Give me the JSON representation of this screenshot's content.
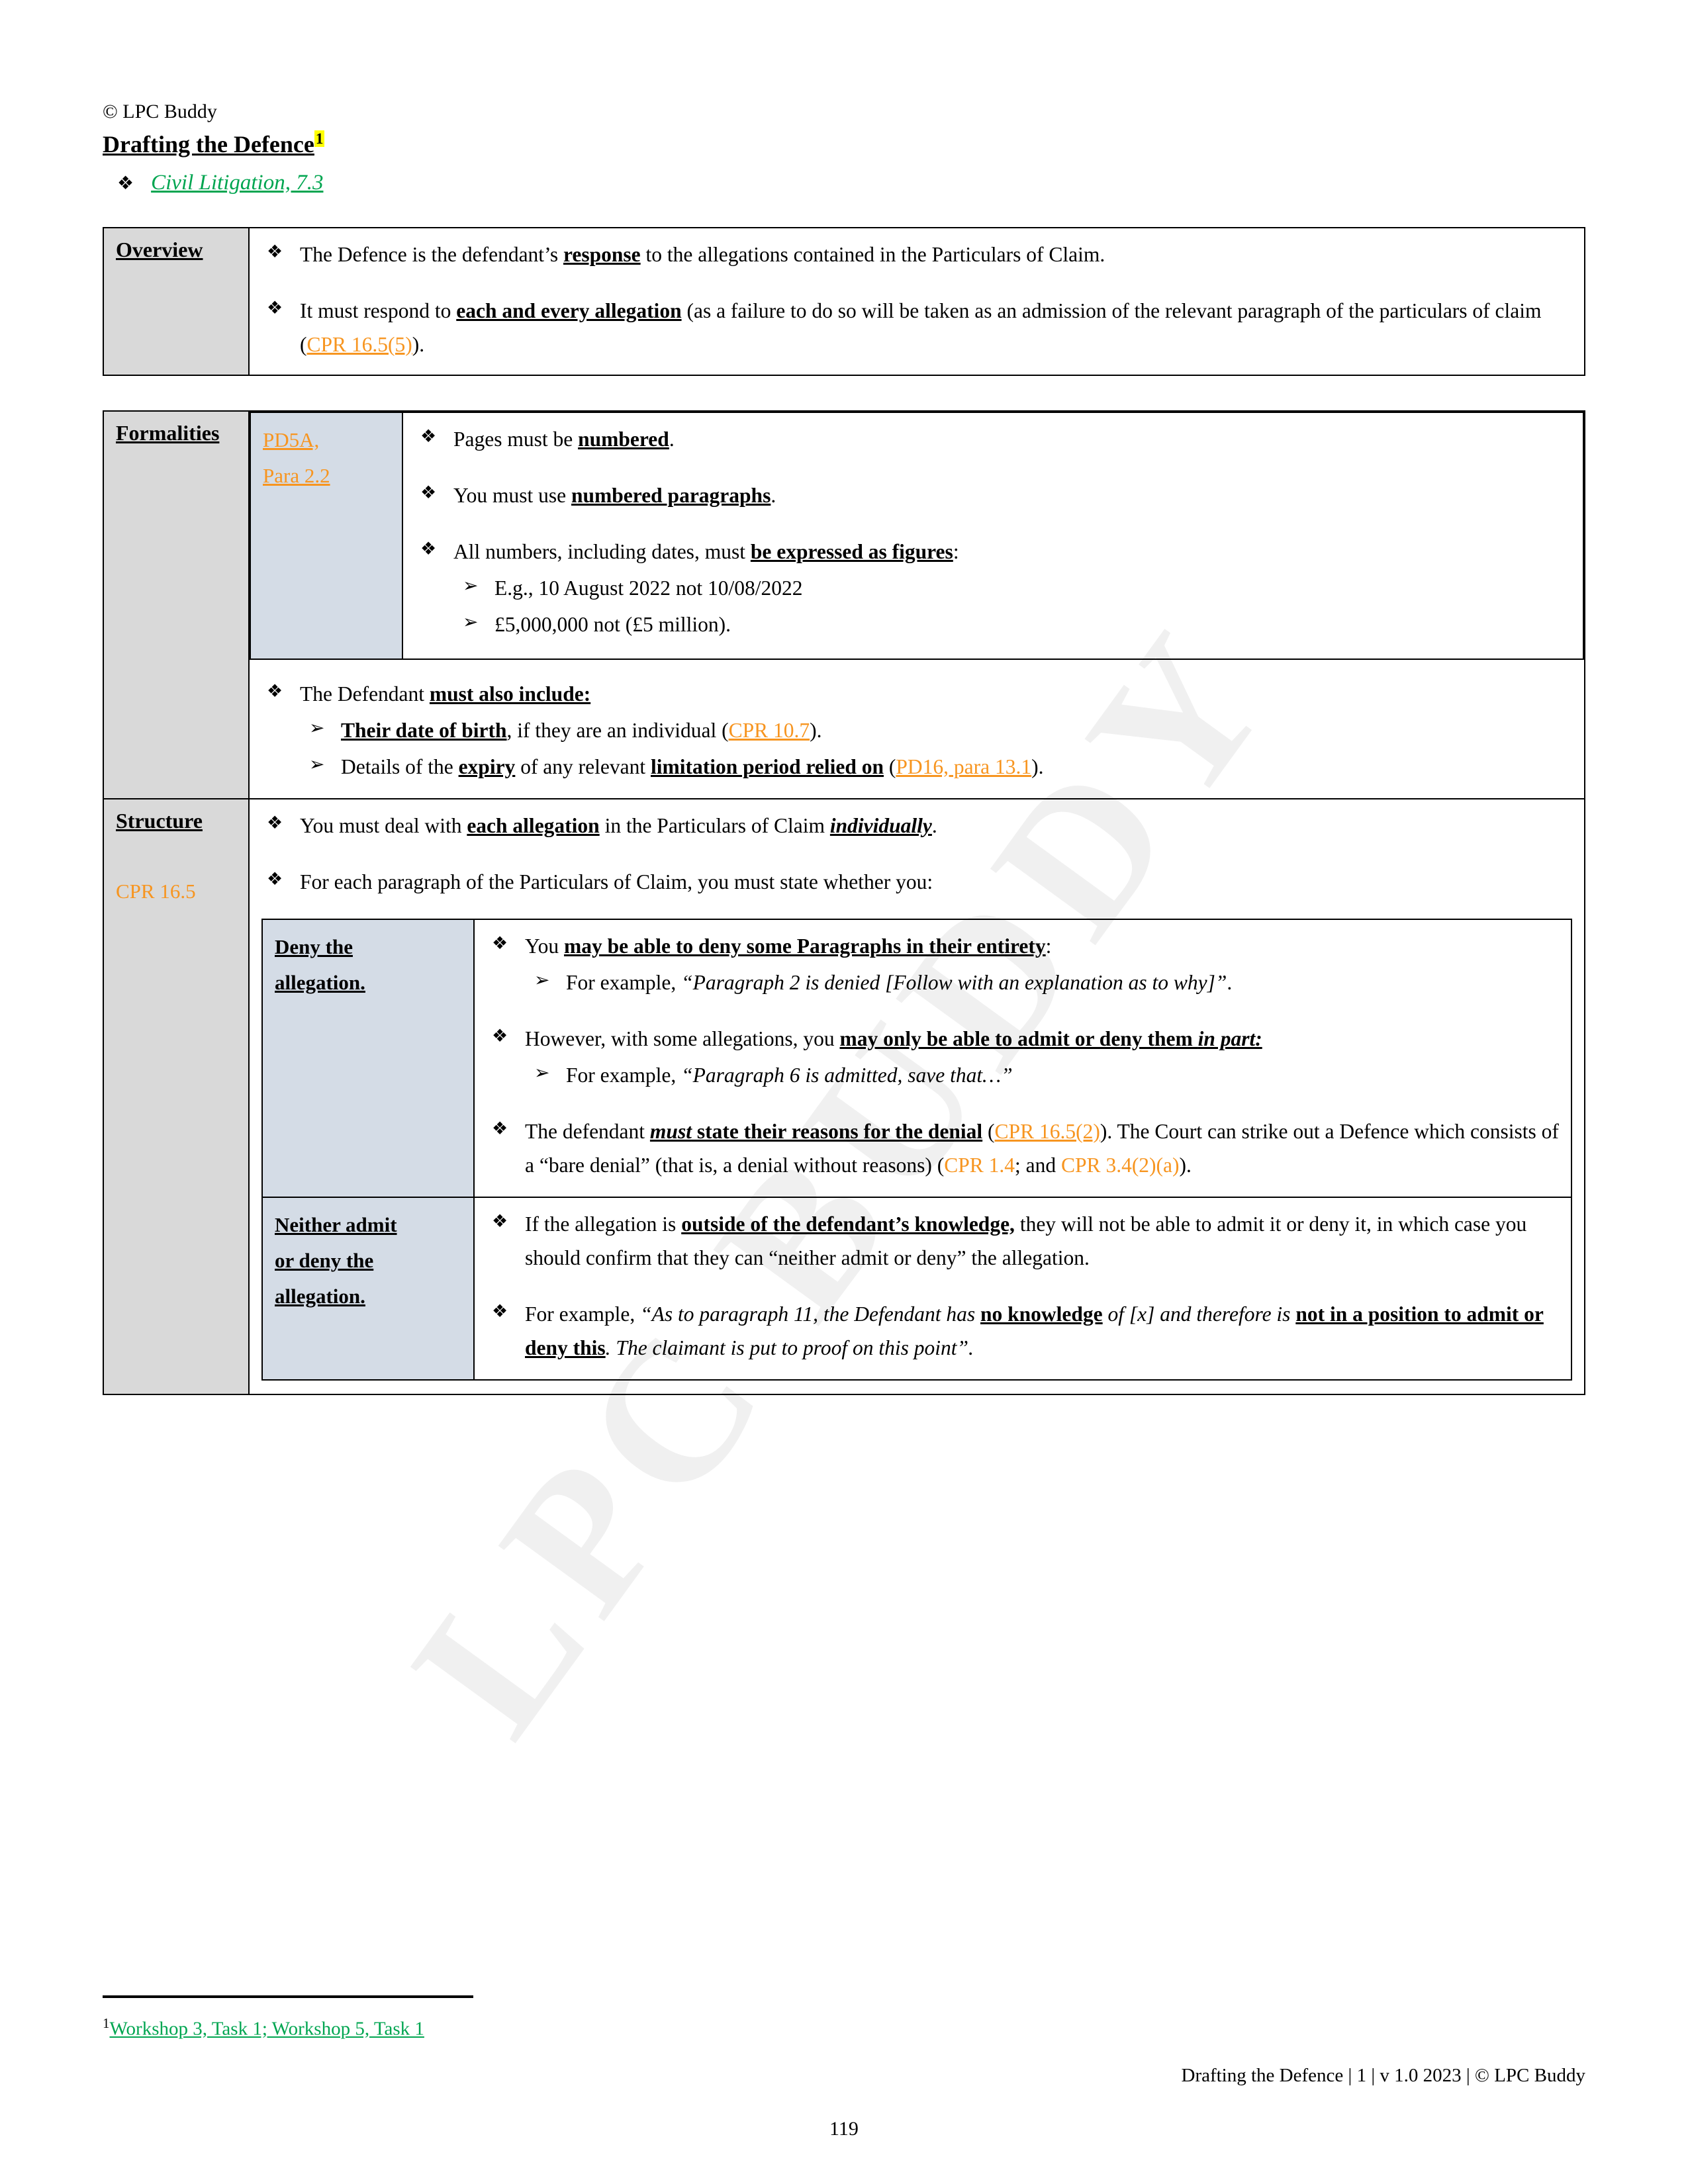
{
  "header": {
    "copyright": "© LPC Buddy",
    "title": "Drafting the Defence",
    "footnote_marker": "1",
    "subject_link": "Civil Litigation, 7.3"
  },
  "overview": {
    "label": "Overview",
    "bullets": [
      {
        "parts": [
          {
            "t": "The Defence is the defendant’s ",
            "s": "plain"
          },
          {
            "t": "response",
            "s": "bu"
          },
          {
            "t": " to the allegations contained in the Particulars of Claim.",
            "s": "plain"
          }
        ]
      },
      {
        "parts": [
          {
            "t": "It must respond to ",
            "s": "plain"
          },
          {
            "t": "each and every allegation",
            "s": "bu"
          },
          {
            "t": " (as a failure to do so will be taken as an admission of the relevant paragraph of the particulars of claim (",
            "s": "plain"
          },
          {
            "t": "CPR 16.5(5)",
            "s": "link"
          },
          {
            "t": ").",
            "s": "plain"
          }
        ]
      }
    ]
  },
  "formalities": {
    "label": "Formalities",
    "citation_lines": [
      "PD5A,",
      "Para 2.2"
    ],
    "bullets": [
      {
        "parts": [
          {
            "t": "Pages must be ",
            "s": "plain"
          },
          {
            "t": "numbered",
            "s": "bu"
          },
          {
            "t": ".",
            "s": "plain"
          }
        ]
      },
      {
        "parts": [
          {
            "t": "You must use ",
            "s": "plain"
          },
          {
            "t": "numbered paragraphs",
            "s": "bu"
          },
          {
            "t": ".",
            "s": "plain"
          }
        ]
      },
      {
        "parts": [
          {
            "t": "All numbers, including dates, must ",
            "s": "plain"
          },
          {
            "t": "be expressed as figures",
            "s": "bu"
          },
          {
            "t": ":",
            "s": "plain"
          }
        ],
        "sub": [
          {
            "parts": [
              {
                "t": "E.g., 10 August 2022 not 10/08/2022",
                "s": "plain"
              }
            ]
          },
          {
            "parts": [
              {
                "t": "£5,000,000 not (£5 million).",
                "s": "plain"
              }
            ]
          }
        ]
      }
    ],
    "outer_bullets": [
      {
        "parts": [
          {
            "t": "The Defendant ",
            "s": "plain"
          },
          {
            "t": "must also include:",
            "s": "bu"
          }
        ],
        "sub": [
          {
            "parts": [
              {
                "t": "Their date of birth",
                "s": "bu"
              },
              {
                "t": ", if they are an individual (",
                "s": "plain"
              },
              {
                "t": "CPR 10.7",
                "s": "link"
              },
              {
                "t": ").",
                "s": "plain"
              }
            ]
          },
          {
            "parts": [
              {
                "t": "Details of the ",
                "s": "plain"
              },
              {
                "t": "expiry",
                "s": "bu"
              },
              {
                "t": " of any relevant ",
                "s": "plain"
              },
              {
                "t": "limitation period relied on",
                "s": "bu"
              },
              {
                "t": " (",
                "s": "plain"
              },
              {
                "t": "PD16, para 13.1",
                "s": "link"
              },
              {
                "t": ").",
                "s": "plain"
              }
            ]
          }
        ]
      }
    ]
  },
  "structure": {
    "label": "Structure",
    "citation": "CPR 16.5",
    "bullets": [
      {
        "parts": [
          {
            "t": "You must deal with ",
            "s": "plain"
          },
          {
            "t": "each allegation",
            "s": "bu"
          },
          {
            "t": " in the Particulars of Claim ",
            "s": "plain"
          },
          {
            "t": "individually",
            "s": "biu"
          },
          {
            "t": ".",
            "s": "plain"
          }
        ]
      },
      {
        "parts": [
          {
            "t": "For each paragraph of the Particulars of Claim, you must state whether you:",
            "s": "plain"
          }
        ]
      }
    ],
    "inner_rows": [
      {
        "label_lines": [
          "Deny the",
          "allegation."
        ],
        "bullets": [
          {
            "parts": [
              {
                "t": "You ",
                "s": "plain"
              },
              {
                "t": "may be able to deny some Paragraphs in their entirety",
                "s": "bu"
              },
              {
                "t": ":",
                "s": "plain"
              }
            ],
            "sub": [
              {
                "parts": [
                  {
                    "t": "For example, ",
                    "s": "plain"
                  },
                  {
                    "t": "“Paragraph 2 is denied [Follow with an explanation as to why]”",
                    "s": "i"
                  },
                  {
                    "t": ".",
                    "s": "plain"
                  }
                ]
              }
            ]
          },
          {
            "parts": [
              {
                "t": "However, with some allegations, you ",
                "s": "plain"
              },
              {
                "t": "may only be able to admit or deny them ",
                "s": "bu"
              },
              {
                "t": "in part:",
                "s": "biu"
              }
            ],
            "sub": [
              {
                "parts": [
                  {
                    "t": "For example, ",
                    "s": "plain"
                  },
                  {
                    "t": "“Paragraph 6 is admitted, save that…”",
                    "s": "i"
                  }
                ]
              }
            ]
          },
          {
            "parts": [
              {
                "t": "The defendant ",
                "s": "plain"
              },
              {
                "t": "must",
                "s": "biu"
              },
              {
                "t": " state their reasons for the denial",
                "s": "bu"
              },
              {
                "t": " (",
                "s": "plain"
              },
              {
                "t": "CPR 16.5(2)",
                "s": "link"
              },
              {
                "t": "). The Court can strike out a Defence which consists of a “bare denial” (that is, a denial without reasons) (",
                "s": "plain"
              },
              {
                "t": "CPR 1.4",
                "s": "linkplain"
              },
              {
                "t": "; and ",
                "s": "plain"
              },
              {
                "t": "CPR 3.4(2)(a)",
                "s": "linkplain"
              },
              {
                "t": ").",
                "s": "plain"
              }
            ]
          }
        ]
      },
      {
        "label_lines": [
          "Neither admit",
          "or deny the",
          "allegation."
        ],
        "bullets": [
          {
            "parts": [
              {
                "t": "If the allegation is ",
                "s": "plain"
              },
              {
                "t": "outside of the defendant’s knowledge,",
                "s": "bu"
              },
              {
                "t": " they will not be able to admit it or deny it, in which case you should confirm that they can “neither admit or deny” the allegation.",
                "s": "plain"
              }
            ]
          },
          {
            "parts": [
              {
                "t": "For example, ",
                "s": "plain"
              },
              {
                "t": "“As to paragraph 11, the Defendant has ",
                "s": "i"
              },
              {
                "t": "no knowledge",
                "s": "bu"
              },
              {
                "t": " of [x] and therefore is ",
                "s": "i"
              },
              {
                "t": "not in a position to admit or deny this",
                "s": "bu"
              },
              {
                "t": ". The claimant is put to proof on this point”.",
                "s": "i"
              }
            ]
          }
        ]
      }
    ]
  },
  "footer": {
    "footnote_number": "1",
    "footnote_text": "Workshop 3, Task 1; Workshop 5, Task 1",
    "right_text": "Drafting the Defence | 1 | v 1.0 2023 | © LPC Buddy",
    "page_number": "119"
  },
  "watermark": {
    "text": "LPC BUDDY"
  },
  "colors": {
    "link_orange": "#F79520",
    "link_green": "#00A550",
    "header_grey": "#d9d9d9",
    "sub_blue": "#d4dce6",
    "highlight_yellow": "#ffff00"
  }
}
